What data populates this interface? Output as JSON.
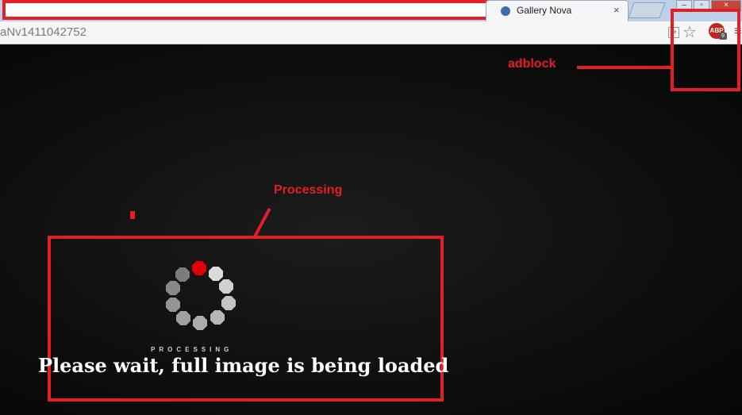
{
  "browser": {
    "tab_title": "Gallery Nova",
    "tab_close": "×",
    "url": "aNv1411042752",
    "window_controls": {
      "minimize": "–",
      "maximize": "▫",
      "close": "×"
    },
    "extensions": {
      "abp_label": "ABP",
      "abp_badge": "9"
    },
    "icons": [
      "translate-icon",
      "star-icon",
      "adblock-icon",
      "menu-icon"
    ]
  },
  "annotations": {
    "adblock_label": "adblock",
    "processing_label": "Processing",
    "color": "#e31e24"
  },
  "loader": {
    "processing_text": "PROCESSING",
    "message": "Please wait, full image is being loaded",
    "active_dot_color": "#e30000"
  }
}
